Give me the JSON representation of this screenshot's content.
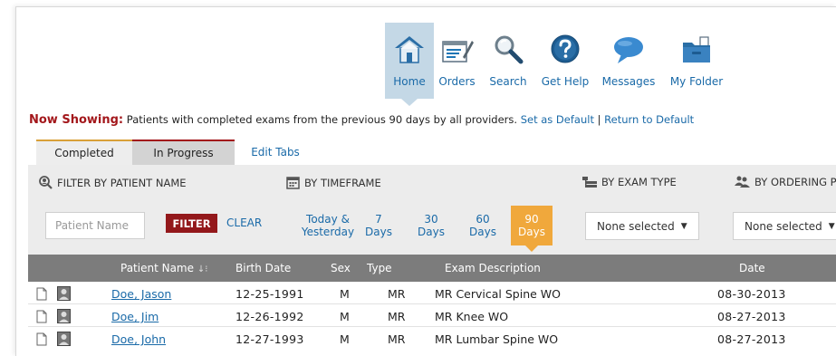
{
  "nav": {
    "items": [
      {
        "label": "Home",
        "icon": "home-icon",
        "active": true
      },
      {
        "label": "Orders",
        "icon": "clipboard-pen-icon"
      },
      {
        "label": "Search",
        "icon": "magnifier-icon"
      },
      {
        "label": "Get Help",
        "icon": "help-icon"
      },
      {
        "label": "Messages",
        "icon": "speech-bubble-icon"
      },
      {
        "label": "My Folder",
        "icon": "folder-icon"
      }
    ]
  },
  "now_showing": {
    "heading": "Now Showing:",
    "text": "Patients with completed exams from the previous 90 days by all providers.",
    "set_default": "Set as Default",
    "separator": "|",
    "return_default": "Return to Default"
  },
  "tabs": {
    "completed": "Completed",
    "in_progress": "In Progress",
    "edit": "Edit Tabs"
  },
  "filters": {
    "patient_name": {
      "heading": "FILTER BY PATIENT NAME",
      "placeholder": "Patient Name",
      "filter_button": "FILTER",
      "clear": "CLEAR"
    },
    "timeframe": {
      "heading": "BY TIMEFRAME",
      "options": [
        {
          "line1": "Today &",
          "line2": "Yesterday"
        },
        {
          "line1": "7",
          "line2": "Days"
        },
        {
          "line1": "30",
          "line2": "Days"
        },
        {
          "line1": "60",
          "line2": "Days"
        },
        {
          "line1": "90",
          "line2": "Days",
          "selected": true
        }
      ]
    },
    "exam_type": {
      "heading": "BY EXAM TYPE",
      "value": "None selected"
    },
    "ordering": {
      "heading": "BY ORDERING PR",
      "value": "None selected"
    }
  },
  "table": {
    "columns": {
      "patient_name": "Patient Name",
      "birth_date": "Birth Date",
      "sex": "Sex",
      "type": "Type",
      "exam_description": "Exam Description",
      "date": "Date"
    },
    "rows": [
      {
        "name": "Doe, Jason",
        "birth": "12-25-1991",
        "sex": "M",
        "type": "MR",
        "desc": "MR Cervical Spine WO",
        "date": "08-30-2013"
      },
      {
        "name": "Doe, Jim",
        "birth": "12-26-1992",
        "sex": "M",
        "type": "MR",
        "desc": "MR Knee WO",
        "date": "08-27-2013"
      },
      {
        "name": "Doe, John",
        "birth": "12-27-1993",
        "sex": "M",
        "type": "MR",
        "desc": "MR Lumbar Spine WO",
        "date": "08-27-2013"
      }
    ]
  },
  "colors": {
    "brand_red": "#a3171b",
    "link_blue": "#1a6aa8",
    "accent_orange": "#f0a83c",
    "nav_active": "#c4d8e6",
    "header_gray": "#7c7c7c"
  }
}
